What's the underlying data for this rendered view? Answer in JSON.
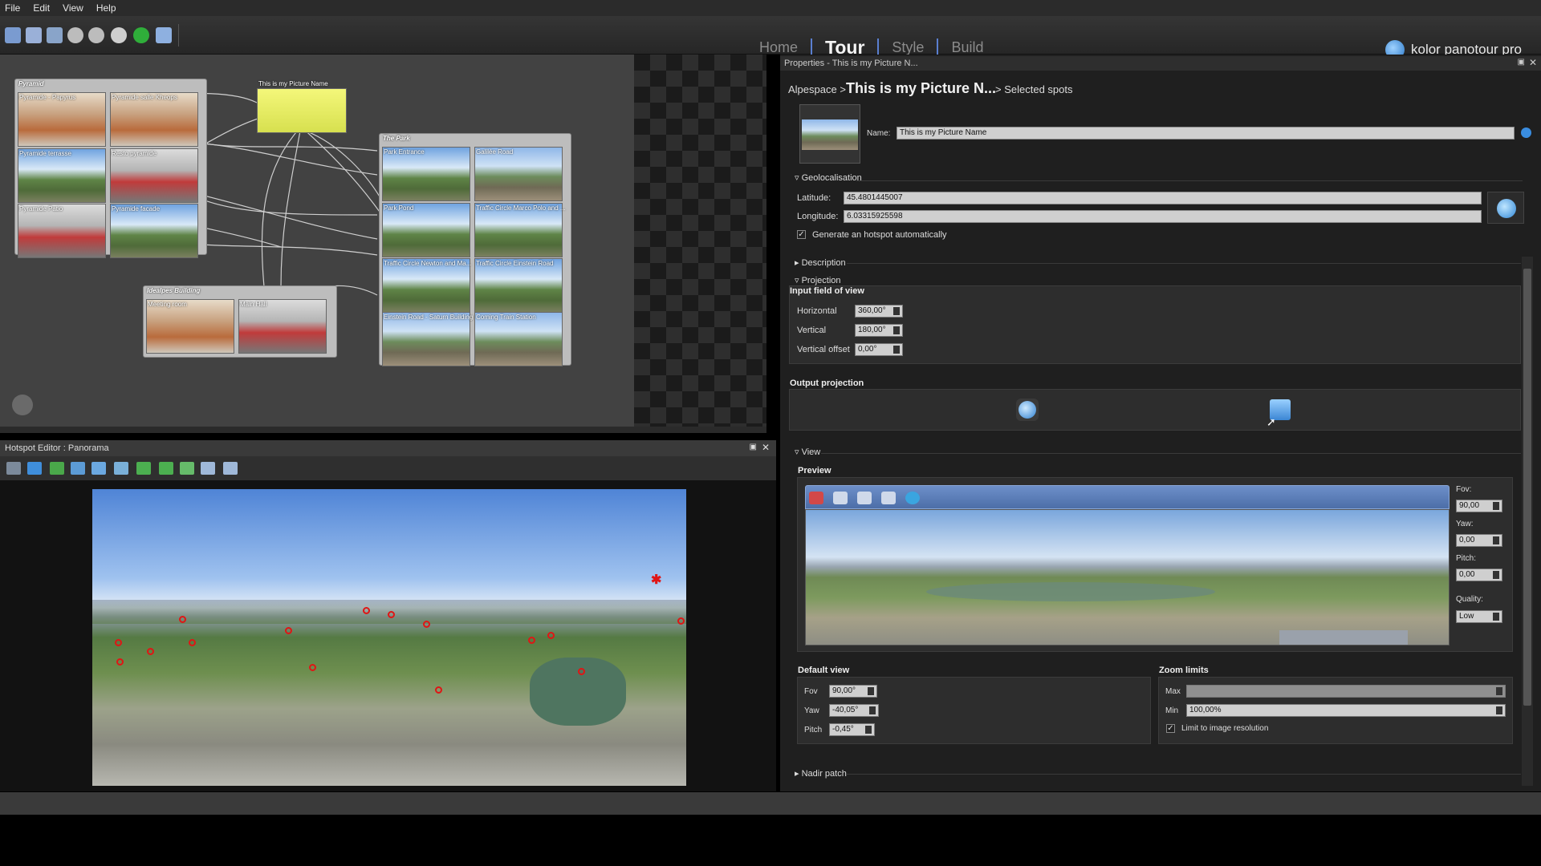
{
  "menu": [
    "File",
    "Edit",
    "View",
    "Help"
  ],
  "tabs": {
    "home": "Home",
    "tour": "Tour",
    "style": "Style",
    "build": "Build"
  },
  "app_name": "kolor panotour pro",
  "graph": {
    "groups": [
      {
        "title": "Pyramid",
        "nodes": [
          "Pyramide - Papyrus",
          "Pyramide salle Kheops",
          "Pyramide terrasse",
          "Resto pyramide",
          "Pyramide Patio",
          "Pyramide facade"
        ]
      },
      {
        "title": "The Park",
        "nodes": [
          "Park Entrance",
          "Galilée Road",
          "Park Pond",
          "Traffic Circle Marco Polo and ...",
          "Traffic Circle Newton and Ma...",
          "Traffic Circle Einstein Road",
          "Einstein Road - Saturn Building",
          "Coming Train Station"
        ]
      },
      {
        "title": "Idealpes Building",
        "nodes": [
          "Meeting room",
          "Main Hall"
        ]
      }
    ],
    "selected_node": "This is my Picture Name"
  },
  "hotspot_editor": {
    "title": "Hotspot Editor : Panorama"
  },
  "properties": {
    "title": "Properties - This is my Picture N...",
    "breadcrumb": {
      "root": "Alpespace >",
      "current": "This is my Picture N...",
      "suffix": "> Selected spots"
    },
    "name_label": "Name:",
    "name_value": "This is my Picture Name",
    "geolocalisation": {
      "header": "Geolocalisation",
      "latitude_label": "Latitude:",
      "latitude": "45.4801445007",
      "longitude_label": "Longitude:",
      "longitude": "6.03315925598",
      "auto_hotspot": "Generate an hotspot automatically"
    },
    "description_header": "Description",
    "projection": {
      "header": "Projection",
      "input_fov": "Input field of view",
      "horizontal_label": "Horizontal",
      "horizontal": "360,00°",
      "vertical_label": "Vertical",
      "vertical": "180,00°",
      "vertical_offset_label": "Vertical offset",
      "vertical_offset": "0,00°",
      "output": "Output projection"
    },
    "view": {
      "header": "View",
      "preview": "Preview",
      "fov_label": "Fov:",
      "fov": "90,00",
      "yaw_label": "Yaw:",
      "yaw": "0,00",
      "pitch_label": "Pitch:",
      "pitch": "0,00",
      "quality_label": "Quality:",
      "quality": "Low",
      "default_view": "Default view",
      "dv_fov_label": "Fov",
      "dv_fov": "90,00°",
      "dv_yaw_label": "Yaw",
      "dv_yaw": "-40,05°",
      "dv_pitch_label": "Pitch",
      "dv_pitch": "-0,45°",
      "zoom_limits": "Zoom limits",
      "max_label": "Max",
      "max": "",
      "min_label": "Min",
      "min": "100,00%",
      "limit_res": "Limit to image resolution"
    },
    "nadir_patch": "Nadir patch"
  },
  "colors": {
    "accent": "#5a7fd0",
    "hotspot": "#e01515",
    "selected_node": "#f4f77a"
  }
}
